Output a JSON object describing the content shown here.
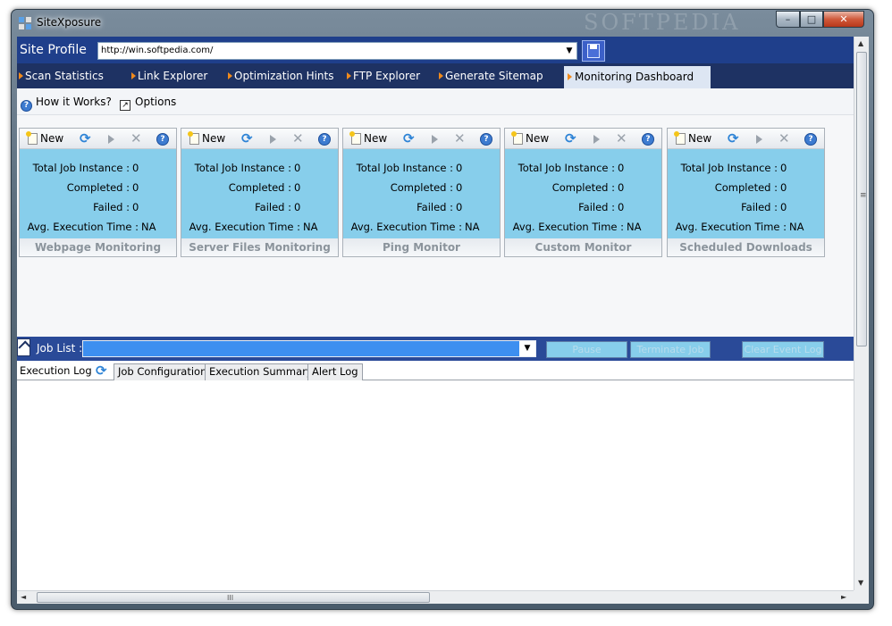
{
  "window": {
    "title": "SiteXposure",
    "watermark": "SOFTPEDIA",
    "minimize": "–",
    "maximize": "□",
    "close": "✕"
  },
  "profile": {
    "label": "Site Profile",
    "url": "http://win.softpedia.com/"
  },
  "nav": {
    "items": [
      "Scan Statistics",
      "Link Explorer",
      "Optimization Hints",
      "FTP Explorer",
      "Generate Sitemap"
    ],
    "active": "Monitoring Dashboard"
  },
  "toolbar": {
    "how_it_works": "How it Works?",
    "options": "Options"
  },
  "panels": [
    {
      "title": "Webpage Monitoring",
      "new_label": "New",
      "total_label": "Total Job Instance :",
      "total": "0",
      "completed_label": "Completed :",
      "completed": "0",
      "failed_label": "Failed :",
      "failed": "0",
      "avg_label": "Avg. Execution Time :",
      "avg": "NA"
    },
    {
      "title": "Server Files Monitoring",
      "new_label": "New",
      "total_label": "Total Job Instance :",
      "total": "0",
      "completed_label": "Completed :",
      "completed": "0",
      "failed_label": "Failed :",
      "failed": "0",
      "avg_label": "Avg. Execution Time :",
      "avg": "NA"
    },
    {
      "title": "Ping Monitor",
      "new_label": "New",
      "total_label": "Total Job Instance :",
      "total": "0",
      "completed_label": "Completed :",
      "completed": "0",
      "failed_label": "Failed :",
      "failed": "0",
      "avg_label": "Avg. Execution Time :",
      "avg": "NA"
    },
    {
      "title": "Custom Monitor",
      "new_label": "New",
      "total_label": "Total Job Instance :",
      "total": "0",
      "completed_label": "Completed :",
      "completed": "0",
      "failed_label": "Failed :",
      "failed": "0",
      "avg_label": "Avg. Execution Time :",
      "avg": "NA"
    },
    {
      "title": "Scheduled Downloads",
      "new_label": "New",
      "total_label": "Total Job Instance :",
      "total": "0",
      "completed_label": "Completed :",
      "completed": "0",
      "failed_label": "Failed :",
      "failed": "0",
      "avg_label": "Avg. Execution Time :",
      "avg": "NA"
    }
  ],
  "jobs": {
    "label": "Job List :",
    "pause": "Pause",
    "terminate": "Terminate Job",
    "clear": "Clear Event Log"
  },
  "log": {
    "execution_log": "Execution Log",
    "tabs": [
      "Job Configuration",
      "Execution Summary",
      "Alert Log"
    ]
  },
  "scroll": {
    "up": "▲",
    "down": "▼",
    "left": "◄",
    "right": "►",
    "vgrip": "≡",
    "hgrip": "III"
  }
}
